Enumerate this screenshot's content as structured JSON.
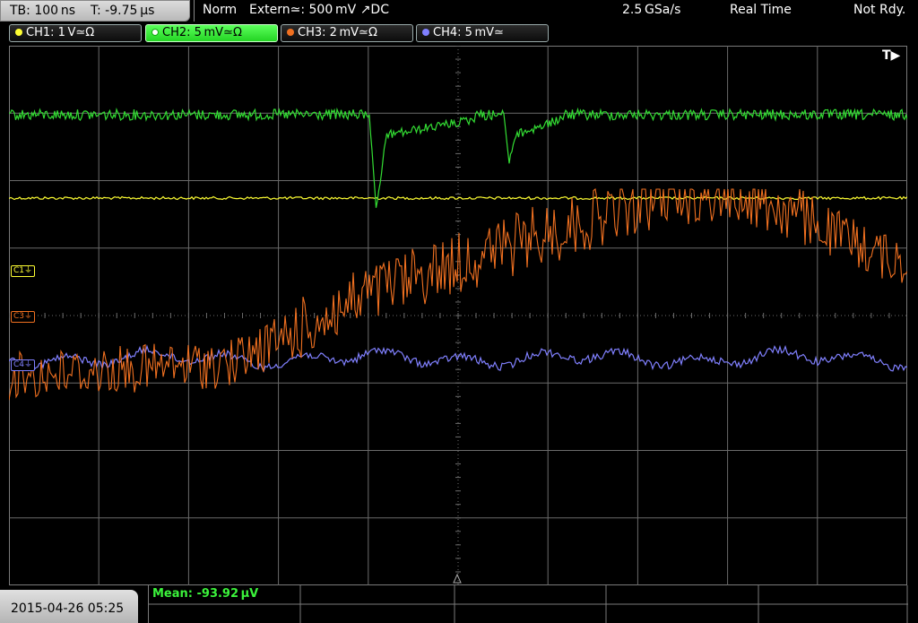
{
  "header": {
    "timebase": "TB: 100 ns",
    "trigger_time": "T: -9.75 µs",
    "mode": "Norm",
    "trigger_source": "Extern≃: 500 mV ↗DC",
    "sample_rate": "2.5 GSa/s",
    "acq_mode": "Real Time",
    "status": "Not Rdy."
  },
  "channels": [
    {
      "label": "CH1: 1 V≃Ω",
      "color": "#ffff33",
      "active": false
    },
    {
      "label": "CH2: 5 mV≃Ω",
      "color": "#33dd33",
      "active": true
    },
    {
      "label": "CH3: 2 mV≃Ω",
      "color": "#f07020",
      "active": false
    },
    {
      "label": "CH4: 5 mV≃",
      "color": "#8080ff",
      "active": false
    }
  ],
  "markers": {
    "c1": "C1⏚",
    "c3": "C3⏚",
    "c4": "C4⏚"
  },
  "trigger_indicator": "T▶",
  "footer": {
    "datetime": "2015-04-26 05:25",
    "measurement": "Mean: -93.92 µV"
  },
  "colors": {
    "grid": "#6b6b6b",
    "ch1": "#ffff33",
    "ch2": "#33dd33",
    "ch3": "#f07020",
    "ch4": "#8080ff"
  }
}
